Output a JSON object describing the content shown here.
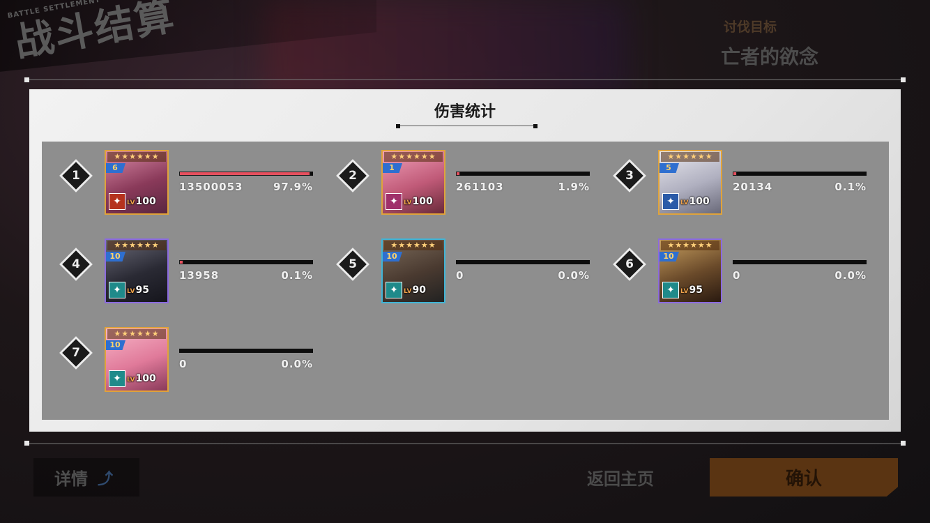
{
  "header": {
    "subtitle": "BATTLE SETTLEMENT",
    "title": "战斗结算",
    "target_label": "讨伐目标",
    "target_name": "亡者的欲念"
  },
  "panel": {
    "title": "伤害统计"
  },
  "entries": [
    {
      "rank": "1",
      "stars": "★★★★★★",
      "badge": "6",
      "lv_prefix": "LV",
      "level": "100",
      "damage": "13500053",
      "percent": "97.9%",
      "fill": 0.979,
      "frame": "gold",
      "class_icon": "guard-icon"
    },
    {
      "rank": "2",
      "stars": "★★★★★★",
      "badge": "1",
      "lv_prefix": "LV",
      "level": "100",
      "damage": "261103",
      "percent": "1.9%",
      "fill": 0.019,
      "frame": "gold",
      "class_icon": "burst-icon"
    },
    {
      "rank": "3",
      "stars": "★★★★★★",
      "badge": "5",
      "lv_prefix": "LV",
      "level": "100",
      "damage": "20134",
      "percent": "0.1%",
      "fill": 0.001,
      "frame": "gold",
      "class_icon": "shield-icon"
    },
    {
      "rank": "4",
      "stars": "★★★★★★",
      "badge": "10",
      "lv_prefix": "LV",
      "level": "95",
      "damage": "13958",
      "percent": "0.1%",
      "fill": 0.001,
      "frame": "purple",
      "class_icon": "support-icon"
    },
    {
      "rank": "5",
      "stars": "★★★★★★",
      "badge": "10",
      "lv_prefix": "LV",
      "level": "90",
      "damage": "0",
      "percent": "0.0%",
      "fill": 0,
      "frame": "blue",
      "class_icon": "support-icon"
    },
    {
      "rank": "6",
      "stars": "★★★★★★",
      "badge": "10",
      "lv_prefix": "LV",
      "level": "95",
      "damage": "0",
      "percent": "0.0%",
      "fill": 0,
      "frame": "purple",
      "class_icon": "support-icon"
    },
    {
      "rank": "7",
      "stars": "★★★★★★",
      "badge": "10",
      "lv_prefix": "LV",
      "level": "100",
      "damage": "0",
      "percent": "0.0%",
      "fill": 0,
      "frame": "gold",
      "class_icon": "support-icon"
    }
  ],
  "buttons": {
    "details": "详情",
    "home": "返回主页",
    "confirm": "确认"
  },
  "colors": {
    "bar": "#e5505e",
    "confirm": "#5a3412",
    "gold": "#e0a33a",
    "purple": "#8b6ae0",
    "blue": "#3fb4d6"
  }
}
